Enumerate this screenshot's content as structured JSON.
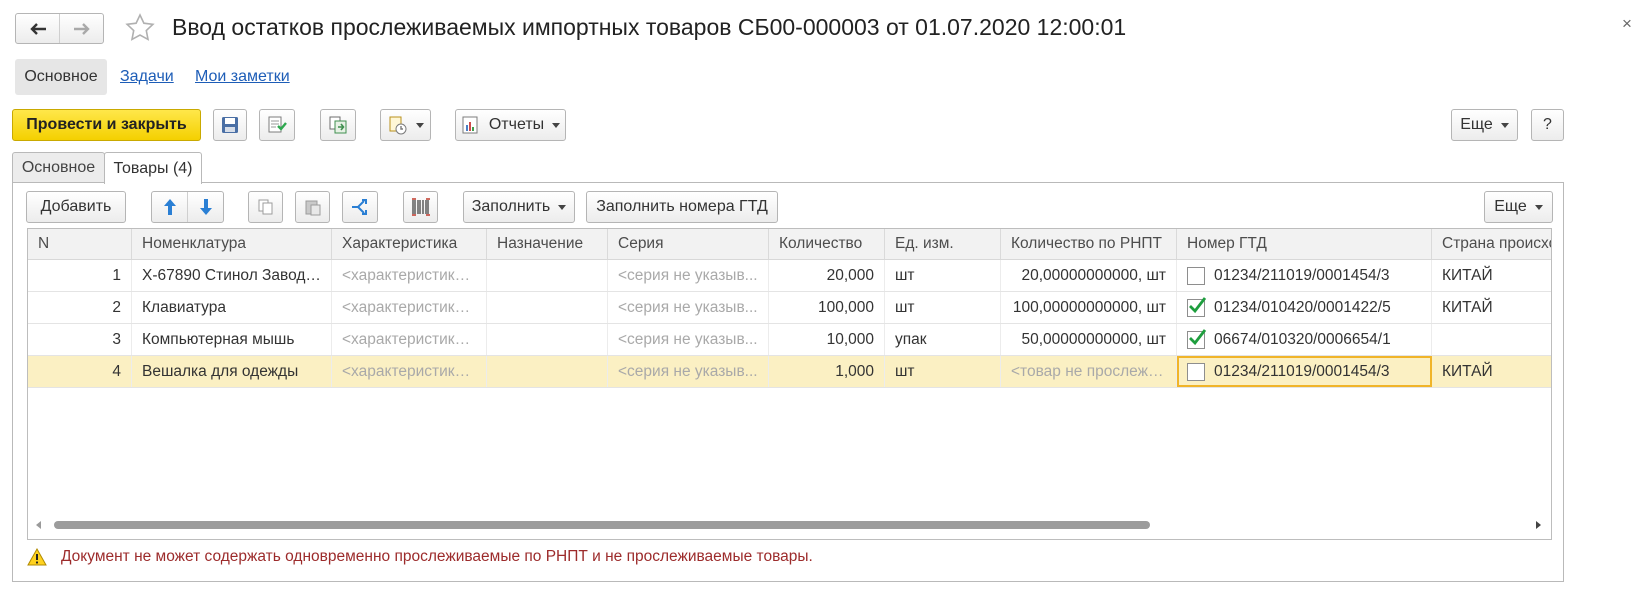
{
  "window": {
    "title": "Ввод остатков прослеживаемых импортных товаров СБ00-000003 от 01.07.2020 12:00:01",
    "close_glyph": "×"
  },
  "form_tabs": {
    "main": "Основное",
    "tasks": "Задачи",
    "notes": "Мои заметки"
  },
  "toolbar": {
    "post_close": "Провести и закрыть",
    "reports": "Отчеты",
    "more": "Еще",
    "help": "?"
  },
  "inner_tabs": {
    "main": "Основное",
    "goods": "Товары (4)"
  },
  "table_toolbar": {
    "add": "Добавить",
    "fill": "Заполнить",
    "fill_gtd": "Заполнить номера ГТД",
    "more": "Еще"
  },
  "table": {
    "columns": [
      "N",
      "Номенклатура",
      "Характеристика",
      "Назначение",
      "Серия",
      "Количество",
      "Ед. изм.",
      "Количество по РНПТ",
      "Номер ГТД",
      "Страна происхо"
    ],
    "rows": [
      {
        "n": "1",
        "item": "Х-67890 Стинол Завод ...",
        "characteristic": "<характеристики ...",
        "purpose": "",
        "series": "<серия не указыв...",
        "qty": "20,000",
        "unit": "шт",
        "qty_rnpt": "20,00000000000, шт",
        "gtd_checked": false,
        "gtd": "01234/211019/0001454/3",
        "country": "КИТАЙ"
      },
      {
        "n": "2",
        "item": "Клавиатура",
        "characteristic": "<характеристики ...",
        "purpose": "",
        "series": "<серия не указыв...",
        "qty": "100,000",
        "unit": "шт",
        "qty_rnpt": "100,00000000000, шт",
        "gtd_checked": true,
        "gtd": "01234/010420/0001422/5",
        "country": "КИТАЙ"
      },
      {
        "n": "3",
        "item": "Компьютерная мышь",
        "characteristic": "<характеристики ...",
        "purpose": "",
        "series": "<серия не указыв...",
        "qty": "10,000",
        "unit": "упак",
        "qty_rnpt": "50,00000000000, шт",
        "gtd_checked": true,
        "gtd": "06674/010320/0006654/1",
        "country": ""
      },
      {
        "n": "4",
        "item": "Вешалка для одежды",
        "characteristic": "<характеристики ...",
        "purpose": "",
        "series": "<серия не указыв...",
        "qty": "1,000",
        "unit": "шт",
        "qty_rnpt": "<товар не прослежи...",
        "gtd_checked": false,
        "gtd": "01234/211019/0001454/3",
        "country": "КИТАЙ"
      }
    ]
  },
  "warning": {
    "text": "Документ не может содержать одновременно прослеживаемые по РНПТ и не прослеживаемые товары."
  },
  "colors": {
    "accent_yellow": "#f4d000",
    "link_blue": "#1d5db7",
    "selected_row": "#fbf0c3",
    "focus_border": "#f0b429",
    "warning_text": "#9c2b2b",
    "arrow_blue": "#2a7fd4"
  },
  "icons": [
    "back-arrow-icon",
    "forward-arrow-icon",
    "star-icon",
    "save-icon",
    "post-icon",
    "structure-icon",
    "create-based-icon",
    "reports-icon",
    "move-up-icon",
    "move-down-icon",
    "copy-icon",
    "paste-icon",
    "split-icon",
    "barcode-icon",
    "warning-icon",
    "checkbox-checked-icon"
  ]
}
